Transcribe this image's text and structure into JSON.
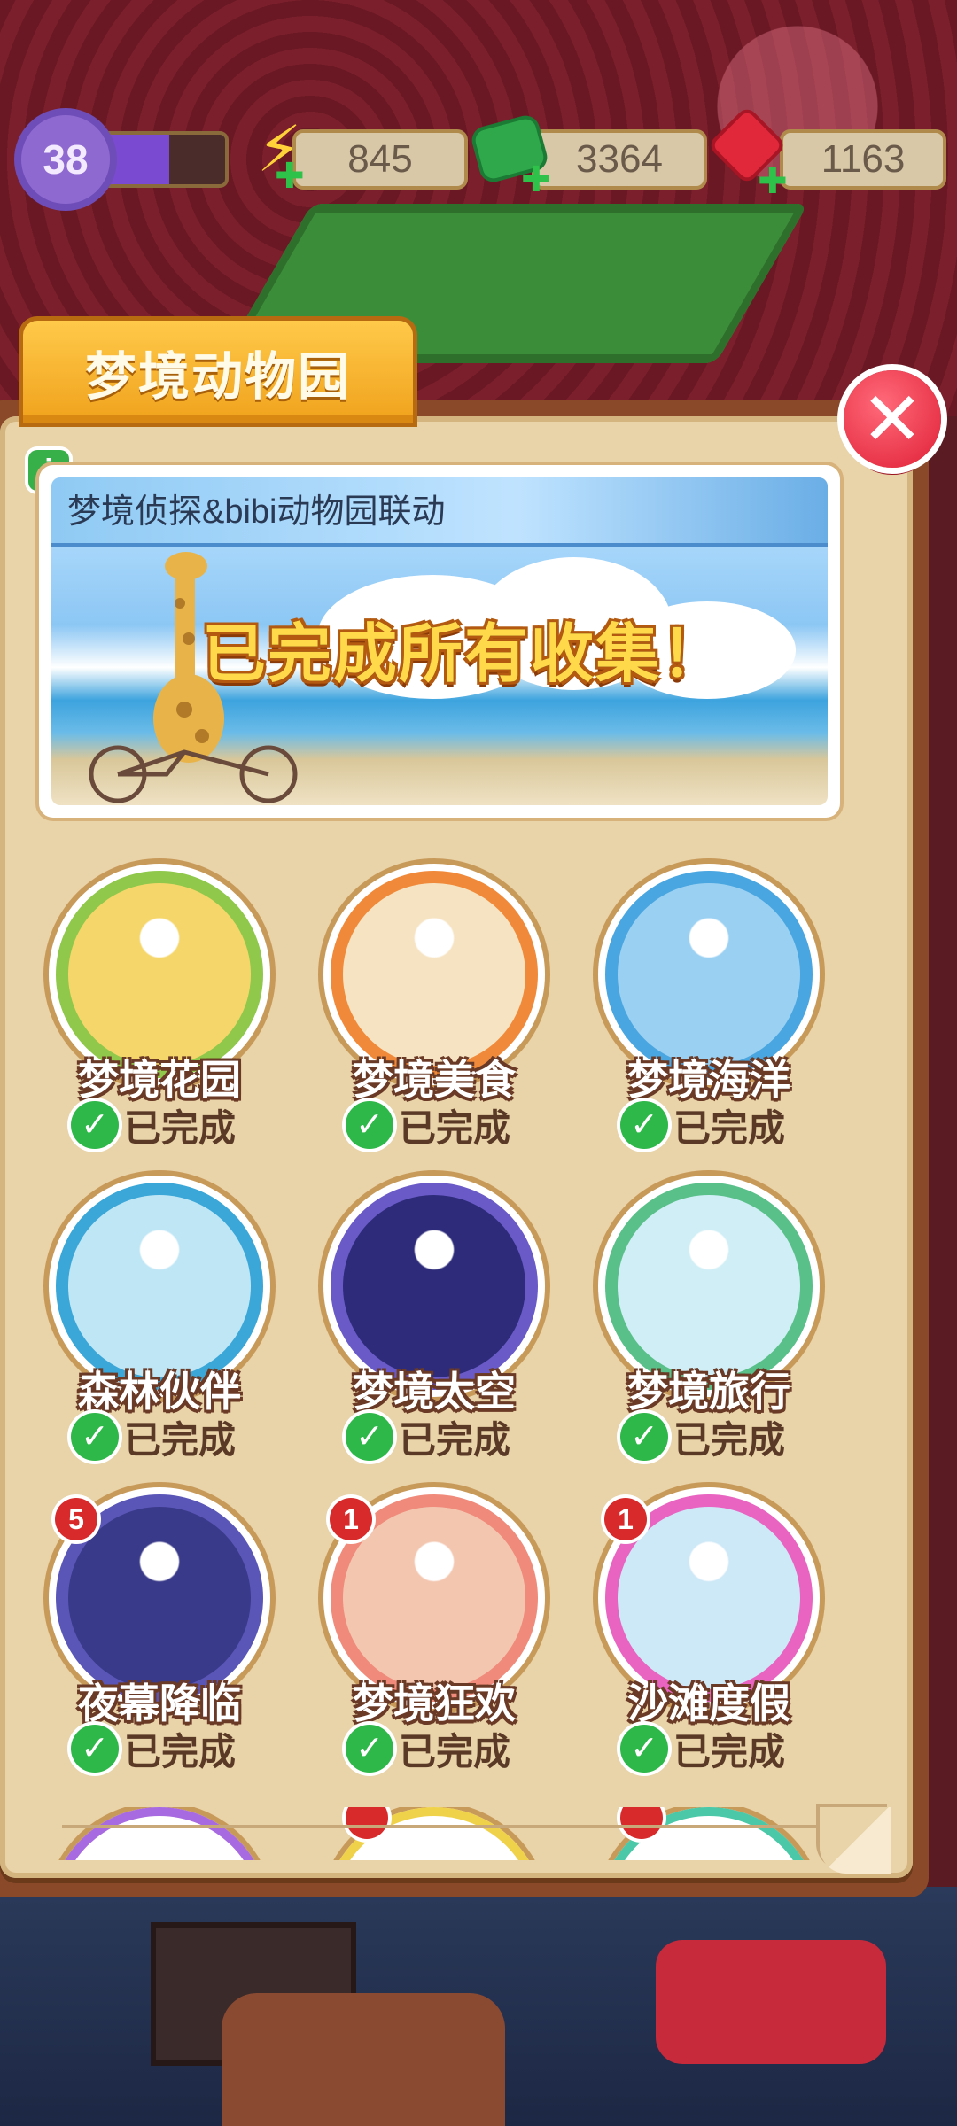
{
  "hud": {
    "level": "38",
    "xp_progress": 0.55,
    "energy": "845",
    "cash": "3364",
    "gems": "1163"
  },
  "panel": {
    "title": "梦境动物园",
    "close_icon": "close-icon"
  },
  "banner": {
    "header": "梦境侦探&bibi动物园联动",
    "message": "已完成所有收集！"
  },
  "collections": [
    {
      "name": "梦境花园",
      "status": "已完成",
      "ring": "#8fc84a",
      "bg": "#f5d66a",
      "badge": ""
    },
    {
      "name": "梦境美食",
      "status": "已完成",
      "ring": "#f08a3a",
      "bg": "#f6e3c2",
      "badge": ""
    },
    {
      "name": "梦境海洋",
      "status": "已完成",
      "ring": "#4aa6e0",
      "bg": "#9ad0f2",
      "badge": ""
    },
    {
      "name": "森林伙伴",
      "status": "已完成",
      "ring": "#3aa7d8",
      "bg": "#bfe6f5",
      "badge": ""
    },
    {
      "name": "梦境太空",
      "status": "已完成",
      "ring": "#6a5ac8",
      "bg": "#2e2c7a",
      "badge": ""
    },
    {
      "name": "梦境旅行",
      "status": "已完成",
      "ring": "#5ac08a",
      "bg": "#cfeef5",
      "badge": ""
    },
    {
      "name": "夜幕降临",
      "status": "已完成",
      "ring": "#5a56b8",
      "bg": "#3a3a8a",
      "badge": "5"
    },
    {
      "name": "梦境狂欢",
      "status": "已完成",
      "ring": "#f08a7a",
      "bg": "#f3c6b0",
      "badge": "1"
    },
    {
      "name": "沙滩度假",
      "status": "已完成",
      "ring": "#e864c0",
      "bg": "#cde8f7",
      "badge": "1"
    }
  ]
}
